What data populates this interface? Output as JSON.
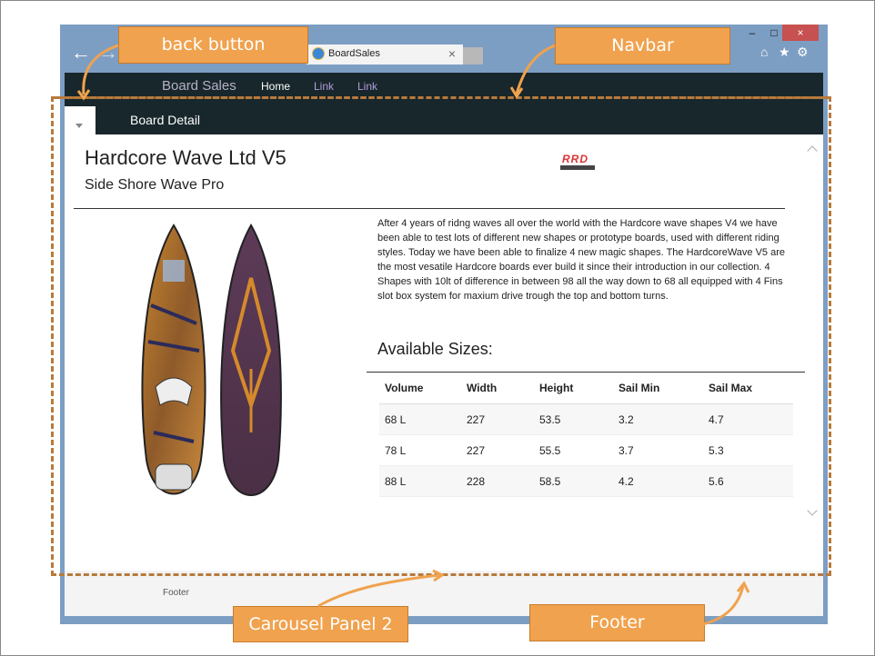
{
  "browser": {
    "tab_title": "BoardSales",
    "tab_close": "×",
    "minimize": "–",
    "maximize": "□",
    "close": "×",
    "back_glyph": "←",
    "forward_glyph": "→",
    "home_glyph": "⌂",
    "star_glyph": "★",
    "gear_glyph": "⚙"
  },
  "navbar": {
    "brand": "Board Sales",
    "links": [
      "Home",
      "Link",
      "Link"
    ]
  },
  "page": {
    "header": "Board Detail",
    "title": "Hardcore Wave Ltd V5",
    "subtitle": "Side Shore Wave Pro",
    "logo_text": "RRD",
    "description": "After 4 years of ridng waves all over the world with the Hardcore wave shapes V4 we have been able to test lots of different new shapes or prototype boards, used with different riding styles. Today we have been able to finalize 4 new magic shapes. The HardcoreWave V5 are the most vesatile Hardcore boards ever build it since their introduction in our collection. 4 Shapes with 10lt of difference in between 98 all the way down to 68 all equipped with 4 Fins slot box system for maxium drive trough the top and bottom turns.",
    "sizes_heading": "Available Sizes:",
    "table": {
      "headers": [
        "Volume",
        "Width",
        "Height",
        "Sail Min",
        "Sail Max"
      ],
      "rows": [
        [
          "68 L",
          "227",
          "53.5",
          "3.2",
          "4.7"
        ],
        [
          "78 L",
          "227",
          "55.5",
          "3.7",
          "5.3"
        ],
        [
          "88 L",
          "228",
          "58.5",
          "4.2",
          "5.6"
        ]
      ]
    },
    "footer": "Footer"
  },
  "annotations": {
    "back_button": "back button",
    "navbar": "Navbar",
    "carousel": "Carousel Panel 2",
    "footer": "Footer"
  },
  "colors": {
    "accent": "#f0a24e",
    "navbar_bg": "#18272b",
    "window_frame": "#7d9ec3",
    "link": "#b19cd9"
  }
}
